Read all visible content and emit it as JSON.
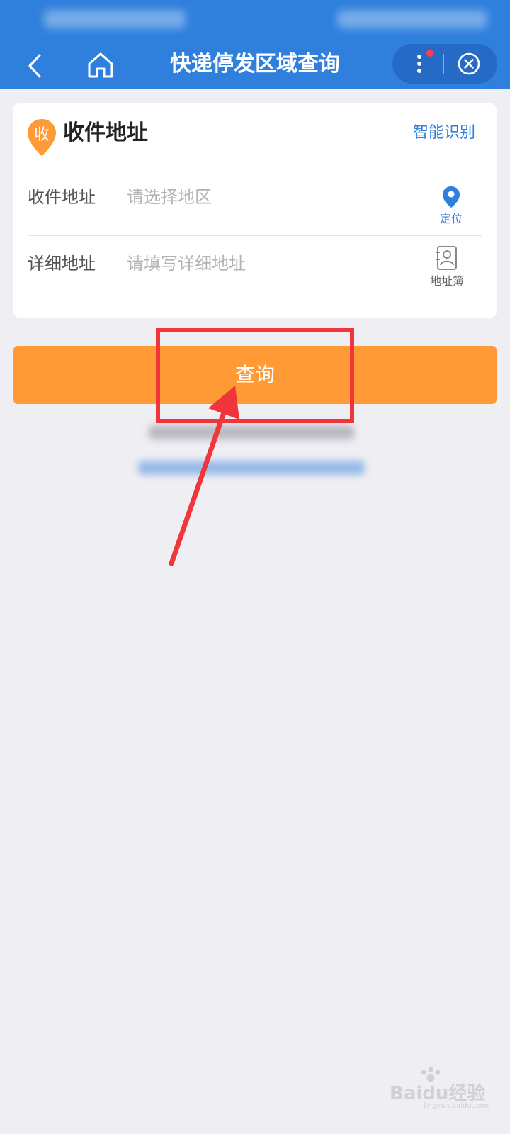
{
  "nav": {
    "title": "快递停发区域查询"
  },
  "section": {
    "badge_char": "收",
    "title": "收件地址",
    "smart_label": "智能识别"
  },
  "form": {
    "address_label": "收件地址",
    "address_placeholder": "请选择地区",
    "address_value": "",
    "detail_label": "详细地址",
    "detail_placeholder": "请填写详细地址",
    "detail_value": "",
    "locate_label": "定位",
    "addressbook_label": "地址簿"
  },
  "query_button": "查询",
  "watermark": {
    "brand": "Baidu经验",
    "url": "jingyan.baidu.com"
  },
  "colors": {
    "primary": "#2f7fdd",
    "accent": "#ff9a36",
    "annotation": "#f0363a"
  },
  "icons": [
    "back-arrow-icon",
    "home-icon",
    "more-dots-icon",
    "close-circle-icon",
    "location-pin-icon",
    "address-book-icon"
  ]
}
